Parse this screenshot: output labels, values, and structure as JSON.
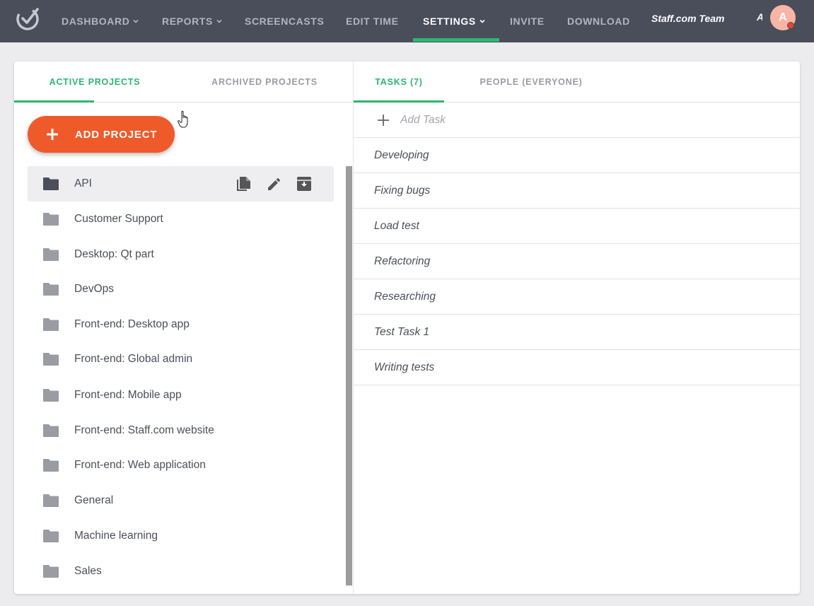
{
  "nav": {
    "items": [
      {
        "label": "DASHBOARD",
        "dropdown": true
      },
      {
        "label": "REPORTS",
        "dropdown": true
      },
      {
        "label": "SCREENCASTS",
        "dropdown": false
      },
      {
        "label": "EDIT TIME",
        "dropdown": false
      },
      {
        "label": "SETTINGS",
        "dropdown": true,
        "active": true
      },
      {
        "label": "INVITE",
        "dropdown": false
      },
      {
        "label": "DOWNLOAD",
        "dropdown": false
      }
    ],
    "team": "Staff.com Team",
    "team_overflow": "A",
    "avatar_initial": "A"
  },
  "projects_panel": {
    "tabs": [
      {
        "label": "ACTIVE PROJECTS",
        "active": true
      },
      {
        "label": "ARCHIVED PROJECTS",
        "active": false
      }
    ],
    "add_button": "ADD PROJECT",
    "projects": [
      {
        "name": "API",
        "selected": true
      },
      {
        "name": "Customer Support"
      },
      {
        "name": "Desktop: Qt part"
      },
      {
        "name": "DevOps"
      },
      {
        "name": "Front-end: Desktop app"
      },
      {
        "name": "Front-end: Global admin"
      },
      {
        "name": "Front-end: Mobile app"
      },
      {
        "name": "Front-end: Staff.com website"
      },
      {
        "name": "Front-end: Web application"
      },
      {
        "name": "General"
      },
      {
        "name": "Machine learning"
      },
      {
        "name": "Sales"
      }
    ],
    "row_actions": [
      "copy-icon",
      "edit-icon",
      "archive-icon"
    ]
  },
  "tasks_panel": {
    "tabs": [
      {
        "label": "TASKS (7)",
        "active": true
      },
      {
        "label": "PEOPLE (EVERYONE)",
        "active": false
      }
    ],
    "add_placeholder": "Add Task",
    "tasks": [
      "Developing",
      "Fixing bugs",
      "Load test",
      "Refactoring",
      "Researching",
      "Test Task 1",
      "Writing tests"
    ]
  },
  "colors": {
    "accent_green": "#2bb673",
    "accent_orange": "#ef5a2a",
    "topbar": "#4a4d5a"
  }
}
